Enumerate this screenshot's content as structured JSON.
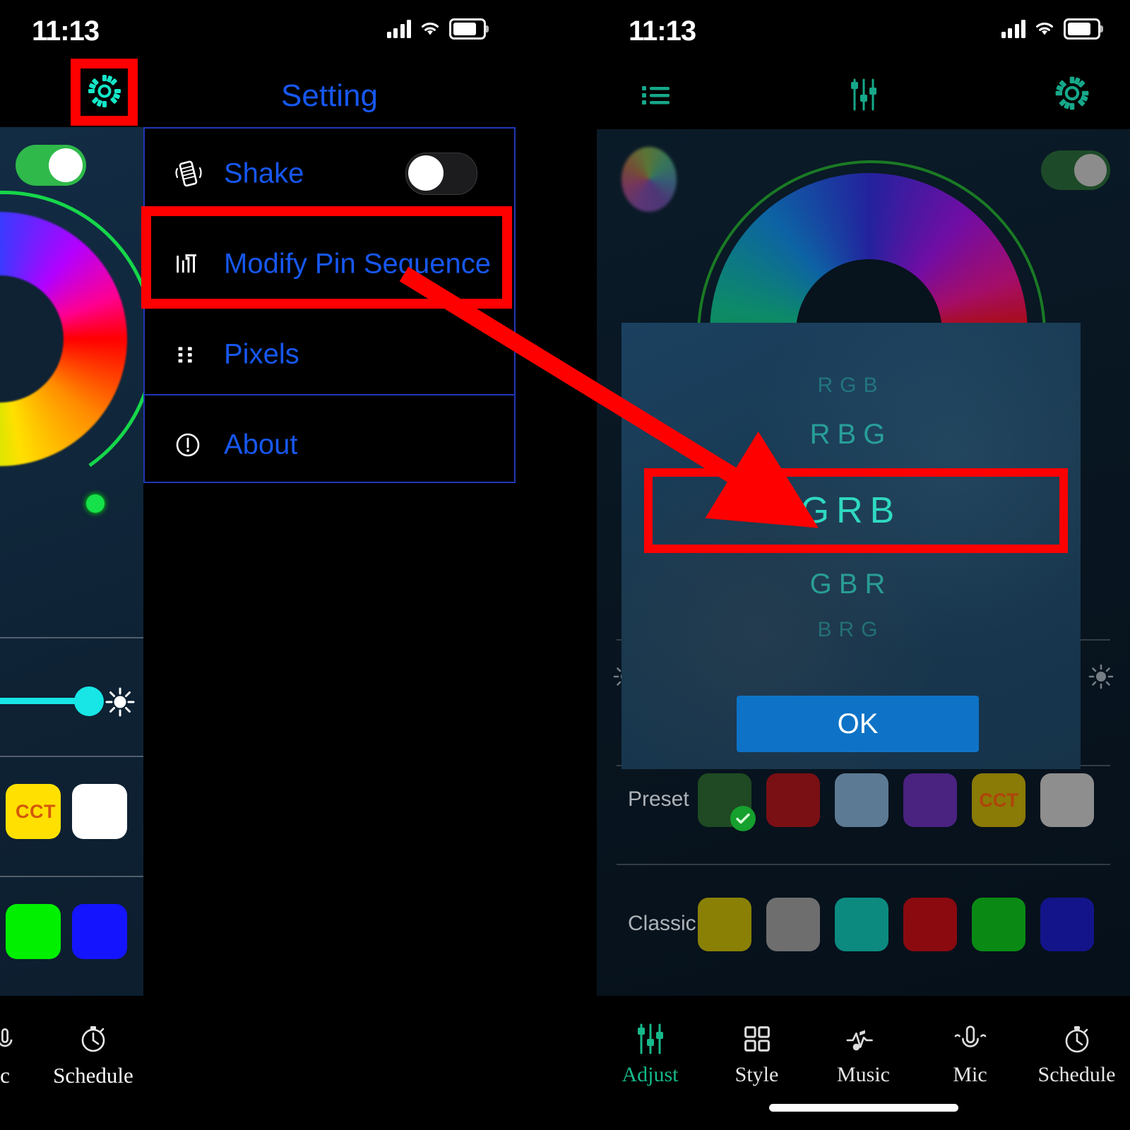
{
  "meta": {
    "domain": "Computer-Use",
    "description": "Two side-by-side iPhone screenshots of an LED controller app: left shows the Setting menu, right shows the Modify Pin Sequence (RGB order) picker dialog",
    "accent_blue": "#1757f0",
    "accent_teal": "#2fd9c0",
    "annotation_red": "#ff0000",
    "ok_button_blue": "#0e73c6"
  },
  "status_bar": {
    "time": "11:13",
    "icons": [
      "cellular-signal-icon",
      "wifi-icon",
      "battery-icon"
    ]
  },
  "left_phone": {
    "app_bar": {
      "gear_icon": "gear-icon",
      "title": "Setting"
    },
    "settings_menu": {
      "items": [
        {
          "label": "Shake",
          "icon": "shake-phone-icon",
          "toggle": {
            "state": "off"
          }
        },
        {
          "label": "Modify Pin Sequence",
          "icon": "pin-sequence-icon"
        },
        {
          "label": "Pixels",
          "icon": "pixels-icon"
        },
        {
          "label": "About",
          "icon": "info-circle-icon"
        }
      ]
    },
    "background_app": {
      "power_toggle": {
        "state": "on"
      },
      "color_wheel": "color-wheel",
      "brightness_slider": {
        "value_pct": 88,
        "icon": "brightness-sun-icon"
      },
      "swatches_row1": [
        {
          "label": "CCT",
          "color": "#ffe000"
        },
        {
          "label": "",
          "color": "#ffffff"
        }
      ],
      "swatches_row2": [
        {
          "label": "",
          "color": "#00f000"
        },
        {
          "label": "",
          "color": "#1414ff"
        }
      ]
    },
    "bottom_nav": [
      {
        "label": "c",
        "icon": "mic-icon",
        "active": false
      },
      {
        "label": "Schedule",
        "icon": "stopwatch-icon",
        "active": false
      }
    ]
  },
  "right_phone": {
    "app_bar": {
      "left_icon": "list-icon",
      "center_icon": "sliders-icon",
      "right_icon": "gear-icon"
    },
    "app": {
      "color_button": "color-picker-circle-icon",
      "power_toggle": {
        "state": "on"
      },
      "color_wheel": "color-wheel",
      "rgb_strip": [
        "#8b0f12",
        "#0f8b1e",
        "#121a8b"
      ],
      "brightness_icons": [
        "brightness-sun-icon",
        "brightness-sun-icon"
      ],
      "preset": {
        "label": "Preset",
        "swatches": [
          {
            "color": "#1f4a23",
            "selected": true
          },
          {
            "color": "#7a0f14",
            "selected": false
          },
          {
            "color": "#5d7a94",
            "selected": false
          },
          {
            "color": "#4a2280",
            "selected": false
          },
          {
            "color": "#8a7a06",
            "label": "CCT",
            "selected": false
          },
          {
            "color": "#8e8e8e",
            "selected": false
          }
        ]
      },
      "classic": {
        "label": "Classic",
        "swatches": [
          {
            "color": "#8a8006"
          },
          {
            "color": "#6e6e6e"
          },
          {
            "color": "#0c8a80"
          },
          {
            "color": "#8a0a10"
          },
          {
            "color": "#0a8a14"
          },
          {
            "color": "#14148a"
          }
        ]
      }
    },
    "dialog": {
      "name": "pin-sequence-picker",
      "options": [
        "RGB",
        "RBG",
        "GRB",
        "GBR",
        "BRG"
      ],
      "selected": "GRB",
      "ok_label": "OK"
    },
    "bottom_nav": [
      {
        "label": "Adjust",
        "icon": "sliders-icon",
        "active": true
      },
      {
        "label": "Style",
        "icon": "grid-icon",
        "active": false
      },
      {
        "label": "Music",
        "icon": "music-wave-icon",
        "active": false
      },
      {
        "label": "Mic",
        "icon": "mic-icon",
        "active": false
      },
      {
        "label": "Schedule",
        "icon": "stopwatch-icon",
        "active": false
      }
    ]
  },
  "annotations": {
    "boxes": [
      {
        "name": "gear-icon-highlight",
        "target": "left gear icon"
      },
      {
        "name": "modify-pin-sequence-highlight",
        "target": "Modify Pin Sequence row"
      },
      {
        "name": "grb-option-highlight",
        "target": "GRB picker option"
      }
    ],
    "arrow": {
      "name": "callout-arrow",
      "from": "Modify Pin Sequence",
      "to": "GRB option"
    }
  }
}
